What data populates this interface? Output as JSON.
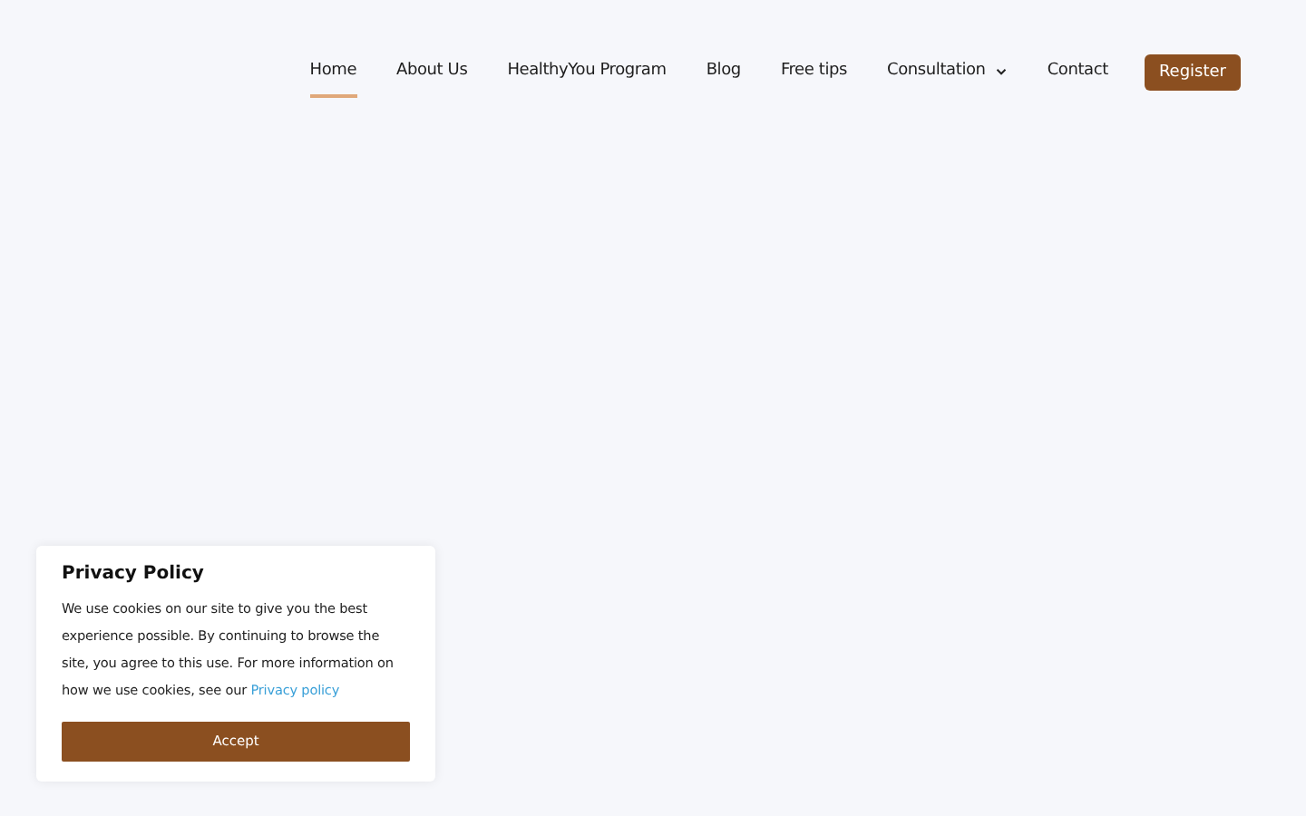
{
  "nav": {
    "items": [
      {
        "label": "Home",
        "selected": true,
        "has_submenu": false
      },
      {
        "label": "About Us",
        "selected": false,
        "has_submenu": false
      },
      {
        "label": "HealthyYou Program",
        "selected": false,
        "has_submenu": false
      },
      {
        "label": "Blog",
        "selected": false,
        "has_submenu": false
      },
      {
        "label": "Free tips",
        "selected": false,
        "has_submenu": false
      },
      {
        "label": "Consultation",
        "selected": false,
        "has_submenu": true
      },
      {
        "label": "Contact",
        "selected": false,
        "has_submenu": false
      }
    ],
    "cta": "Register"
  },
  "cookie_popup": {
    "title": "Privacy Policy",
    "text": "We use cookies on our site to give you the best experience possible. By continuing to browse the site, you agree to this use. For more information on how we use cookies, see our",
    "link": "Privacy policy",
    "button": "Accept"
  }
}
